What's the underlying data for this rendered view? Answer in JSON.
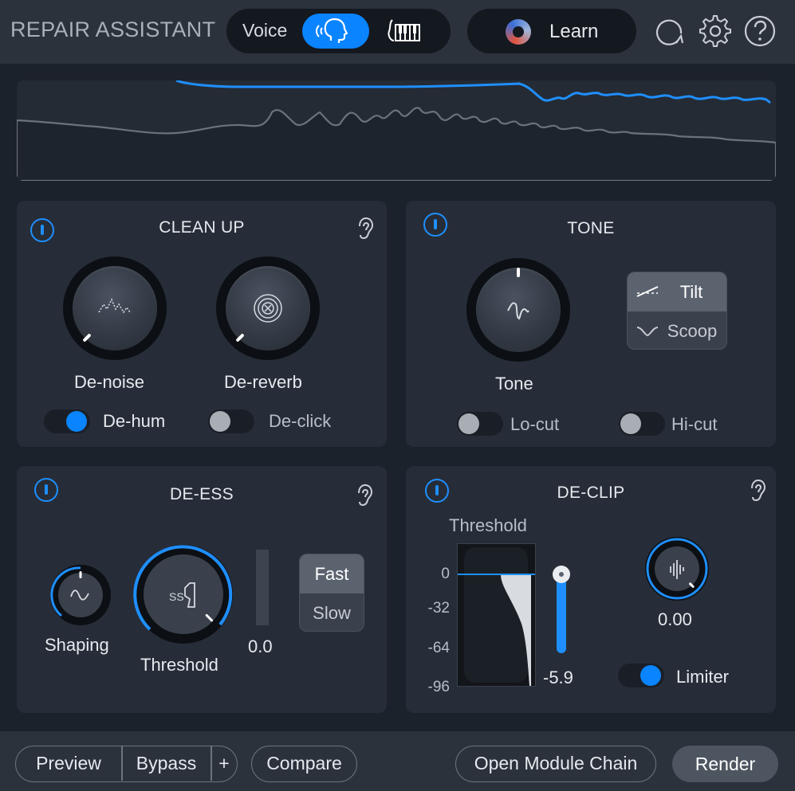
{
  "header": {
    "title": "REPAIR ASSISTANT",
    "mode_label": "Voice",
    "learn_label": "Learn"
  },
  "clean_up": {
    "title": "CLEAN UP",
    "denoise_label": "De-noise",
    "dereverb_label": "De-reverb",
    "dehum_label": "De-hum",
    "dehum_on": true,
    "declick_label": "De-click",
    "declick_on": false
  },
  "tone": {
    "title": "TONE",
    "knob_label": "Tone",
    "tilt_label": "Tilt",
    "scoop_label": "Scoop",
    "selected": "Tilt",
    "locut_label": "Lo-cut",
    "locut_on": false,
    "hicut_label": "Hi-cut",
    "hicut_on": false
  },
  "de_ess": {
    "title": "DE-ESS",
    "shaping_label": "Shaping",
    "threshold_label": "Threshold",
    "meter_value": "0.0",
    "fast_label": "Fast",
    "slow_label": "Slow",
    "selected": "Fast"
  },
  "de_clip": {
    "title": "DE-CLIP",
    "threshold_label": "Threshold",
    "scale": [
      "0",
      "-32",
      "-64",
      "-96"
    ],
    "threshold_value": "-5.9",
    "gain_value": "0.00",
    "limiter_label": "Limiter",
    "limiter_on": true
  },
  "footer": {
    "preview_label": "Preview",
    "bypass_label": "Bypass",
    "plus_label": "+",
    "compare_label": "Compare",
    "module_chain_label": "Open Module Chain",
    "render_label": "Render"
  },
  "colors": {
    "accent": "#0a84ff",
    "background": "#1c222c",
    "panel": "#262d38"
  }
}
